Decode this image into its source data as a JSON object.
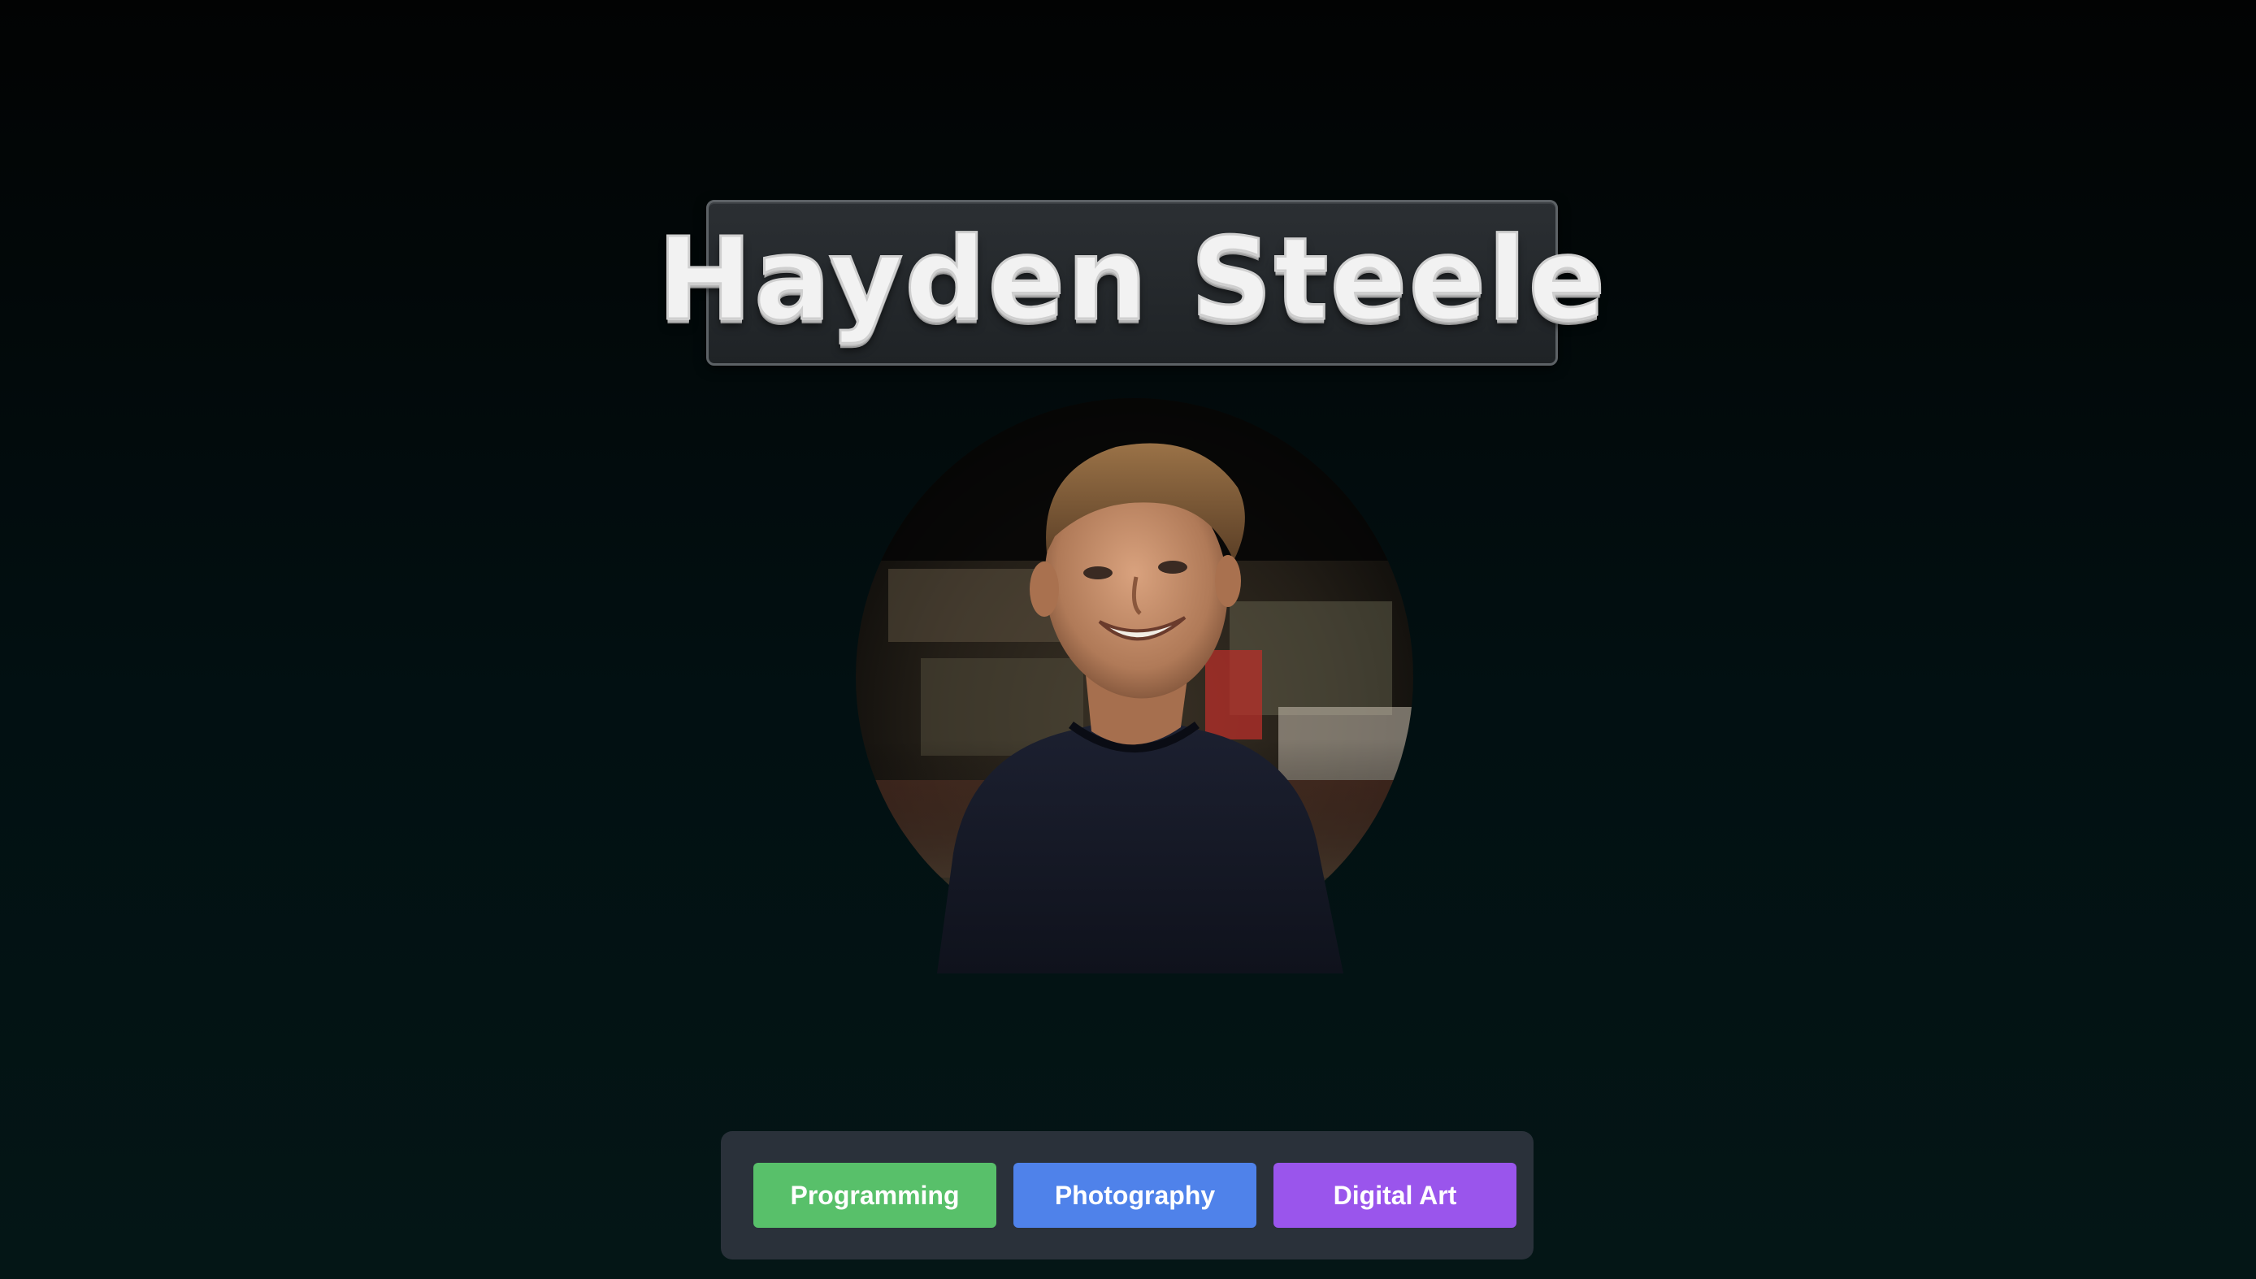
{
  "header": {
    "name": "Hayden Steele"
  },
  "portrait": {
    "icon": "profile-photo"
  },
  "nav": {
    "buttons": [
      {
        "label": "Programming",
        "color": "#58c06a"
      },
      {
        "label": "Photography",
        "color": "#4f82ea"
      },
      {
        "label": "Digital Art",
        "color": "#9a55ec"
      }
    ]
  },
  "colors": {
    "background_top": "#020303",
    "background_bottom": "#041616",
    "button_bar": "#2a313a"
  }
}
